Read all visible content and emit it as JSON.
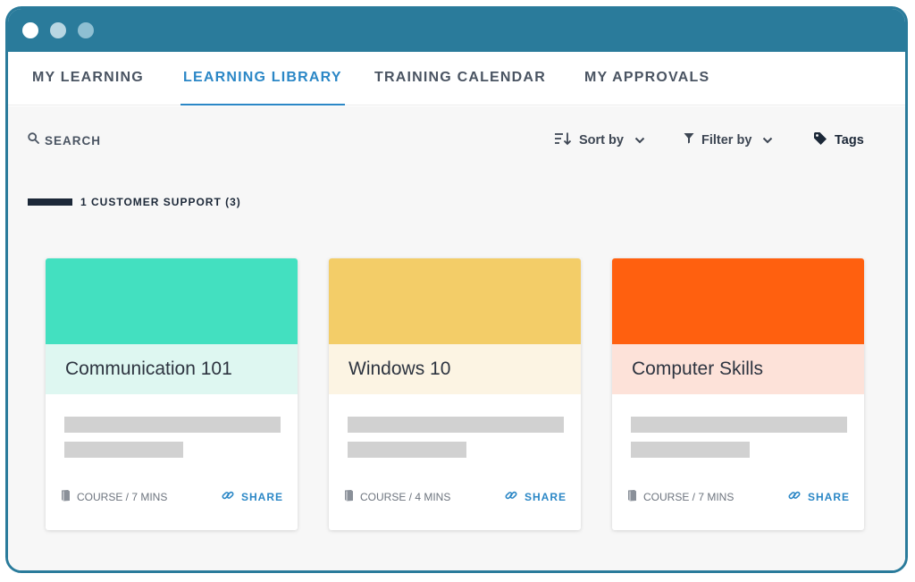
{
  "window": {
    "titlebar_color": "#2a7b9b",
    "controls": [
      "window-dot-1",
      "window-dot-2",
      "window-dot-3"
    ]
  },
  "tabs": [
    {
      "label": "MY LEARNING",
      "active": false
    },
    {
      "label": "LEARNING LIBRARY",
      "active": true
    },
    {
      "label": "TRAINING CALENDAR",
      "active": false
    },
    {
      "label": "MY APPROVALS",
      "active": false
    }
  ],
  "toolbar": {
    "search_label": "SEARCH",
    "sort_label": "Sort by",
    "filter_label": "Filter by",
    "tags_label": "Tags",
    "icons": {
      "search": "search-icon",
      "sort": "sort-icon",
      "filter": "filter-icon",
      "tags": "tag-icon",
      "dropdown": "chevron-down-icon"
    }
  },
  "section": {
    "title": "1 CUSTOMER SUPPORT (3)"
  },
  "cards": [
    {
      "title": "Communication 101",
      "meta": "COURSE / 7 MINS",
      "share_label": "SHARE",
      "color": "#43e0c0",
      "band_color": "#def7f1"
    },
    {
      "title": "Windows 10",
      "meta": "COURSE / 4 MINS",
      "share_label": "SHARE",
      "color": "#f3cd68",
      "band_color": "#fcf4e3"
    },
    {
      "title": "Computer Skills",
      "meta": "COURSE / 7 MINS",
      "share_label": "SHARE",
      "color": "#ff600f",
      "band_color": "#fde2d9"
    }
  ],
  "colors": {
    "accent": "#2b87c6",
    "text_dark": "#2d3440",
    "text_muted": "#4a5462",
    "placeholder": "#d1d1d1"
  }
}
